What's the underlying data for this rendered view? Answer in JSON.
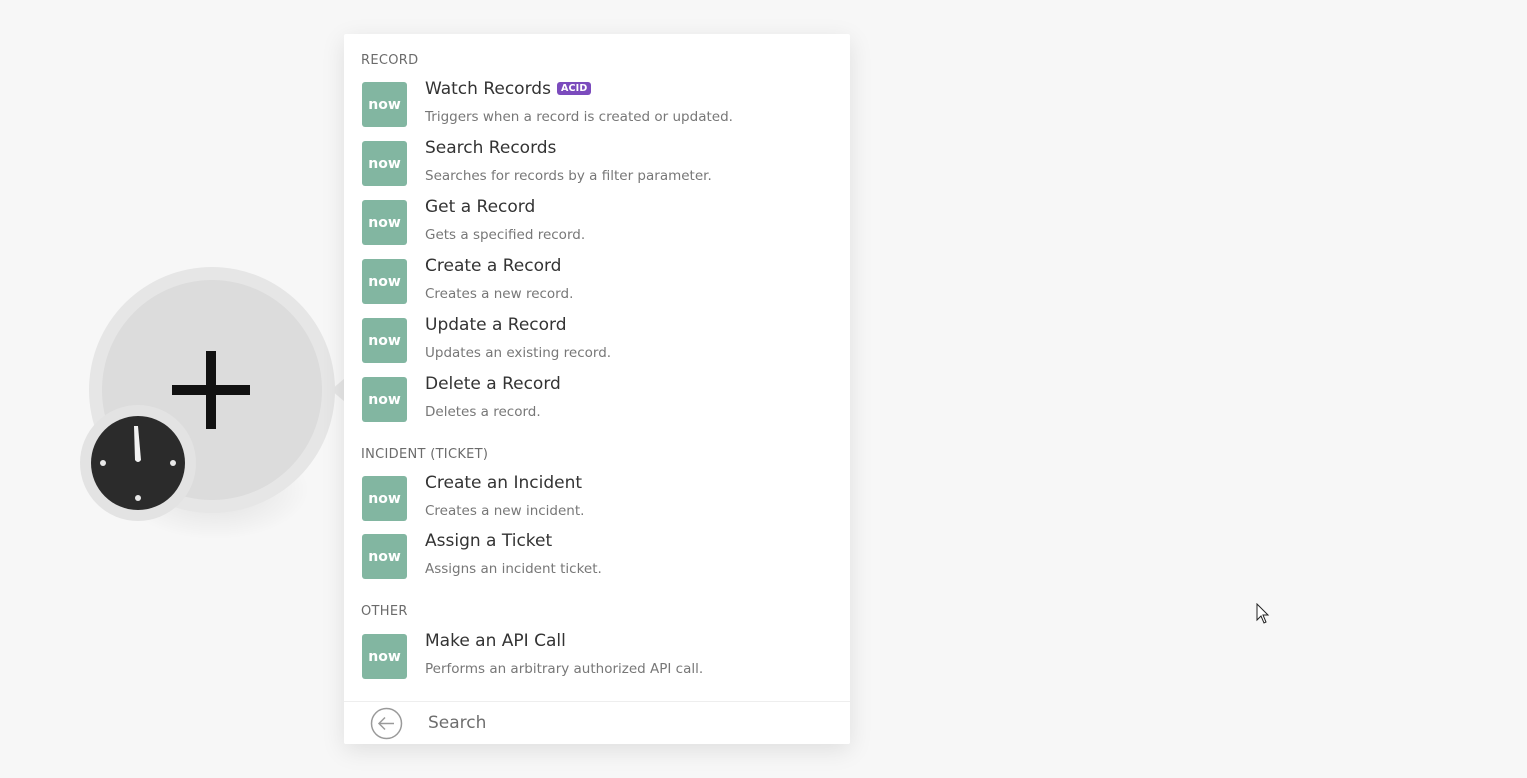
{
  "module": {
    "plus_icon": "plus-icon",
    "clock_icon": "clock-icon"
  },
  "dropdown": {
    "sections": [
      {
        "header": "RECORD",
        "items": [
          {
            "title": "Watch Records",
            "badge": "ACID",
            "description": "Triggers when a record is created or updated.",
            "logo_text": "now"
          },
          {
            "title": "Search Records",
            "description": "Searches for records by a filter parameter.",
            "logo_text": "now"
          },
          {
            "title": "Get a Record",
            "description": "Gets a specified record.",
            "logo_text": "now"
          },
          {
            "title": "Create a Record",
            "description": "Creates a new record.",
            "logo_text": "now"
          },
          {
            "title": "Update a Record",
            "description": "Updates an existing record.",
            "logo_text": "now"
          },
          {
            "title": "Delete a Record",
            "description": "Deletes a record.",
            "logo_text": "now"
          }
        ]
      },
      {
        "header": "INCIDENT (TICKET)",
        "items": [
          {
            "title": "Create an Incident",
            "description": "Creates a new incident.",
            "logo_text": "now"
          },
          {
            "title": "Assign a Ticket",
            "description": "Assigns an incident ticket.",
            "logo_text": "now"
          }
        ]
      },
      {
        "header": "OTHER",
        "items": [
          {
            "title": "Make an API Call",
            "description": "Performs an arbitrary authorized API call.",
            "logo_text": "now"
          }
        ]
      }
    ],
    "search": {
      "placeholder": "Search",
      "value": ""
    }
  },
  "colors": {
    "logo_bg": "#82b6a1",
    "badge_bg": "#7b4bbd",
    "canvas_bg": "#f7f7f7"
  }
}
